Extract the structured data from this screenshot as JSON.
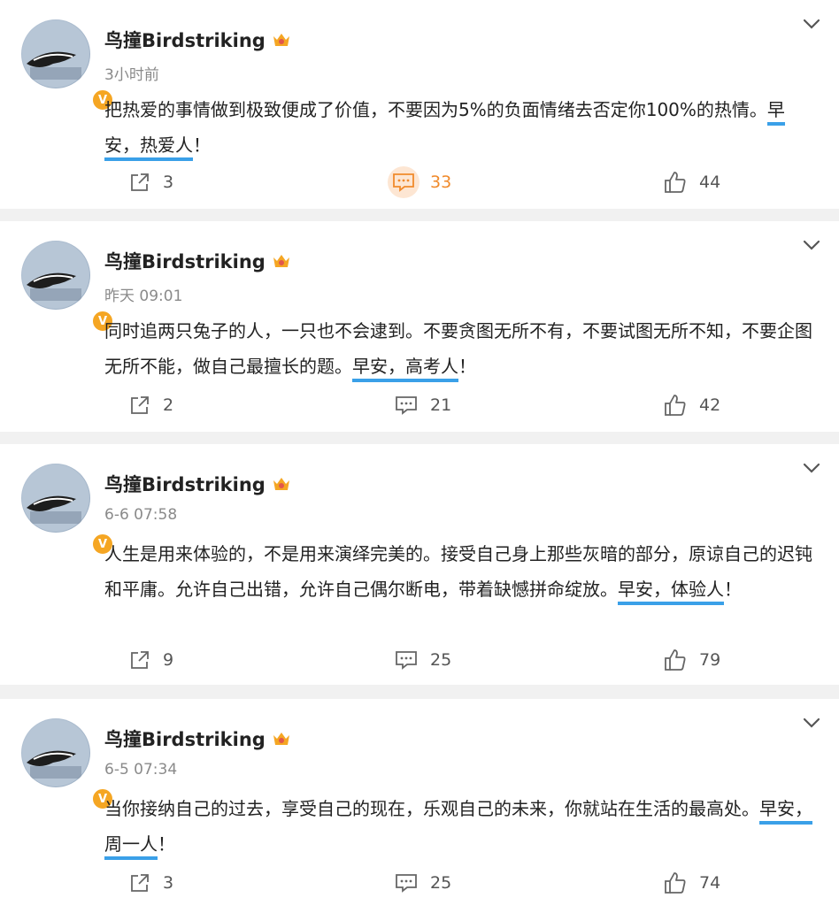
{
  "colors": {
    "highlight_underline": "#3aa0e8",
    "verified_badge": "#f5a623",
    "active_comment": "#f08a2c"
  },
  "posts": [
    {
      "username": "鸟撞Birdstriking",
      "time": "3小时前",
      "text_before": "把热爱的事情做到极致便成了价值，不要因为5%的负面情绪去否定你100%的热情。",
      "highlight": "早安，热爱人",
      "text_after": "！",
      "reposts": "3",
      "comments": "33",
      "likes": "44",
      "comments_active": true
    },
    {
      "username": "鸟撞Birdstriking",
      "time": "昨天 09:01",
      "text_before": "同时追两只兔子的人，一只也不会逮到。不要贪图无所不有，不要试图无所不知，不要企图无所不能，做自己最擅长的题。",
      "highlight": "早安，高考人",
      "text_after": "！",
      "reposts": "2",
      "comments": "21",
      "likes": "42",
      "comments_active": false
    },
    {
      "username": "鸟撞Birdstriking",
      "time": "6-6 07:58",
      "text_before": "人生是用来体验的，不是用来演绎完美的。接受自己身上那些灰暗的部分，原谅自己的迟钝和平庸。允许自己出错，允许自己偶尔断电，带着缺憾拼命绽放。",
      "highlight": "早安，体验人",
      "text_after": "！",
      "reposts": "9",
      "comments": "25",
      "likes": "79",
      "comments_active": false
    },
    {
      "username": "鸟撞Birdstriking",
      "time": "6-5 07:34",
      "text_before": "当你接纳自己的过去，享受自己的现在，乐观自己的未来，你就站在生活的最高处。",
      "highlight": "早安，周一人",
      "text_after": "！",
      "reposts": "3",
      "comments": "25",
      "likes": "74",
      "comments_active": false
    }
  ],
  "icons": {
    "verified": "verified-badge-icon",
    "crown": "crown-badge-icon",
    "more": "chevron-down-icon",
    "repost": "repost-icon",
    "comment": "comment-icon",
    "like": "like-icon"
  },
  "verified_letter": "V"
}
